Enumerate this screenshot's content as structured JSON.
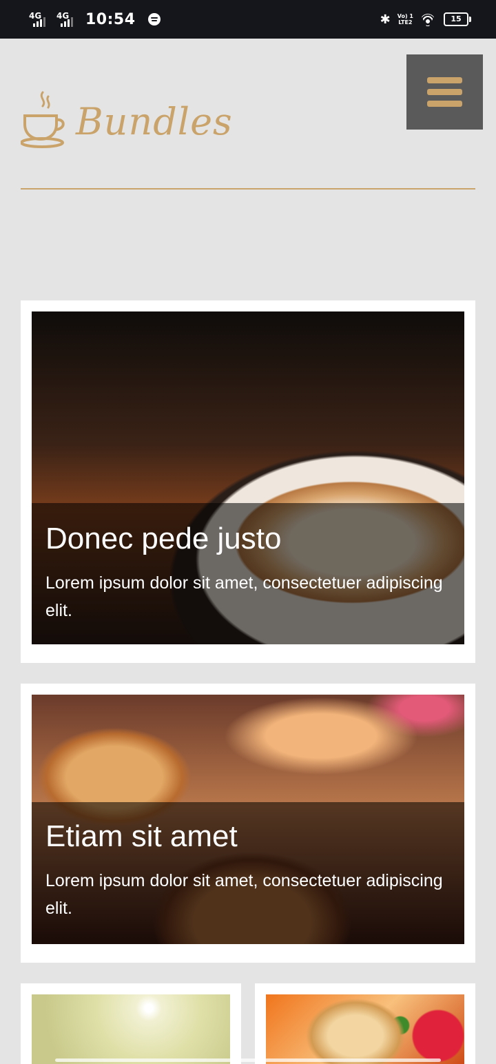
{
  "status_bar": {
    "sim1": "4G",
    "sim2": "4G",
    "time": "10:54",
    "volte_top": "Vo) 1",
    "volte_bottom": "LTE2",
    "battery": "15"
  },
  "header": {
    "brand": "Bundles",
    "menu_icon": "hamburger-menu-icon"
  },
  "colors": {
    "accent": "#c9a36a",
    "menu_bg": "#5a5a5a",
    "page_bg": "#e4e4e4"
  },
  "cards": [
    {
      "title": "Donec pede justo",
      "text": "Lorem ipsum dolor sit amet, consectetuer adipiscing elit."
    },
    {
      "title": "Etiam sit amet",
      "text": "Lorem ipsum dolor sit amet, consectetuer adipiscing elit."
    }
  ]
}
